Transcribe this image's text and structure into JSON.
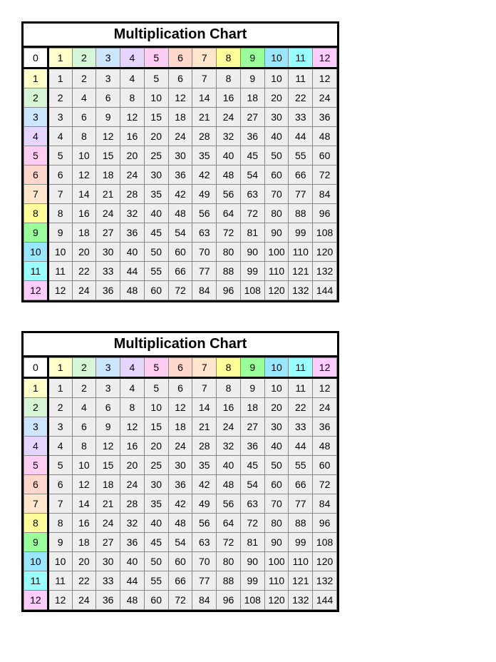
{
  "chart": {
    "title": "Multiplication Chart",
    "zero": "0",
    "labels": [
      "1",
      "2",
      "3",
      "4",
      "5",
      "6",
      "7",
      "8",
      "9",
      "10",
      "11",
      "12"
    ],
    "colors": [
      "c1",
      "c2",
      "c3",
      "c4",
      "c5",
      "c6",
      "c7",
      "c8",
      "c9",
      "c10",
      "c11",
      "c12"
    ],
    "rows": [
      [
        "1",
        "2",
        "3",
        "4",
        "5",
        "6",
        "7",
        "8",
        "9",
        "10",
        "11",
        "12"
      ],
      [
        "2",
        "4",
        "6",
        "8",
        "10",
        "12",
        "14",
        "16",
        "18",
        "20",
        "22",
        "24"
      ],
      [
        "3",
        "6",
        "9",
        "12",
        "15",
        "18",
        "21",
        "24",
        "27",
        "30",
        "33",
        "36"
      ],
      [
        "4",
        "8",
        "12",
        "16",
        "20",
        "24",
        "28",
        "32",
        "36",
        "40",
        "44",
        "48"
      ],
      [
        "5",
        "10",
        "15",
        "20",
        "25",
        "30",
        "35",
        "40",
        "45",
        "50",
        "55",
        "60"
      ],
      [
        "6",
        "12",
        "18",
        "24",
        "30",
        "36",
        "42",
        "48",
        "54",
        "60",
        "66",
        "72"
      ],
      [
        "7",
        "14",
        "21",
        "28",
        "35",
        "42",
        "49",
        "56",
        "63",
        "70",
        "77",
        "84"
      ],
      [
        "8",
        "16",
        "24",
        "32",
        "40",
        "48",
        "56",
        "64",
        "72",
        "80",
        "88",
        "96"
      ],
      [
        "9",
        "18",
        "27",
        "36",
        "45",
        "54",
        "63",
        "72",
        "81",
        "90",
        "99",
        "108"
      ],
      [
        "10",
        "20",
        "30",
        "40",
        "50",
        "60",
        "70",
        "80",
        "90",
        "100",
        "110",
        "120"
      ],
      [
        "11",
        "22",
        "33",
        "44",
        "55",
        "66",
        "77",
        "88",
        "99",
        "110",
        "121",
        "132"
      ],
      [
        "12",
        "24",
        "36",
        "48",
        "60",
        "72",
        "84",
        "96",
        "108",
        "120",
        "132",
        "144"
      ]
    ]
  },
  "copies": 2
}
